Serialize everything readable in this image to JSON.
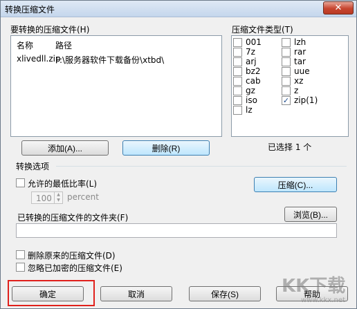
{
  "window": {
    "title": "转换压缩文件",
    "close_glyph": "✕"
  },
  "files": {
    "group_label": "要转换的压缩文件(H)",
    "columns": [
      "名称",
      "路径"
    ],
    "rows": [
      {
        "name": "xlivedll.zip",
        "path": "F:\\服务器软件下载备份\\xtbd\\"
      }
    ],
    "add_button": "添加(A)...",
    "delete_button": "删除(R)"
  },
  "types": {
    "group_label": "压缩文件类型(T)",
    "col1": [
      {
        "label": "001",
        "checked": false
      },
      {
        "label": "7z",
        "checked": false
      },
      {
        "label": "arj",
        "checked": false
      },
      {
        "label": "bz2",
        "checked": false
      },
      {
        "label": "cab",
        "checked": false
      },
      {
        "label": "gz",
        "checked": false
      },
      {
        "label": "iso",
        "checked": false
      },
      {
        "label": "lz",
        "checked": false
      }
    ],
    "col2": [
      {
        "label": "lzh",
        "checked": false
      },
      {
        "label": "rar",
        "checked": false
      },
      {
        "label": "tar",
        "checked": false
      },
      {
        "label": "uue",
        "checked": false
      },
      {
        "label": "xz",
        "checked": false
      },
      {
        "label": "z",
        "checked": false
      },
      {
        "label": "zip(1)",
        "checked": true
      }
    ],
    "selected_count": "已选择 1 个"
  },
  "options": {
    "group_label": "转换选项",
    "allow_min_ratio": "允许的最低比率(L)",
    "percent_value": "100",
    "percent_unit": "percent",
    "compress_button": "压缩(C)...",
    "folder_label": "已转换的压缩文件的文件夹(F)",
    "folder_value": "",
    "browse_button": "浏览(B)...",
    "delete_original": "删除原来的压缩文件(D)",
    "ignore_encrypted": "忽略已加密的压缩文件(E)"
  },
  "buttons": {
    "ok": "确定",
    "cancel": "取消",
    "save": "保存(S)",
    "help": "帮助"
  },
  "watermark": {
    "logo_text": "KK下载",
    "url": "www.kkx.net"
  }
}
